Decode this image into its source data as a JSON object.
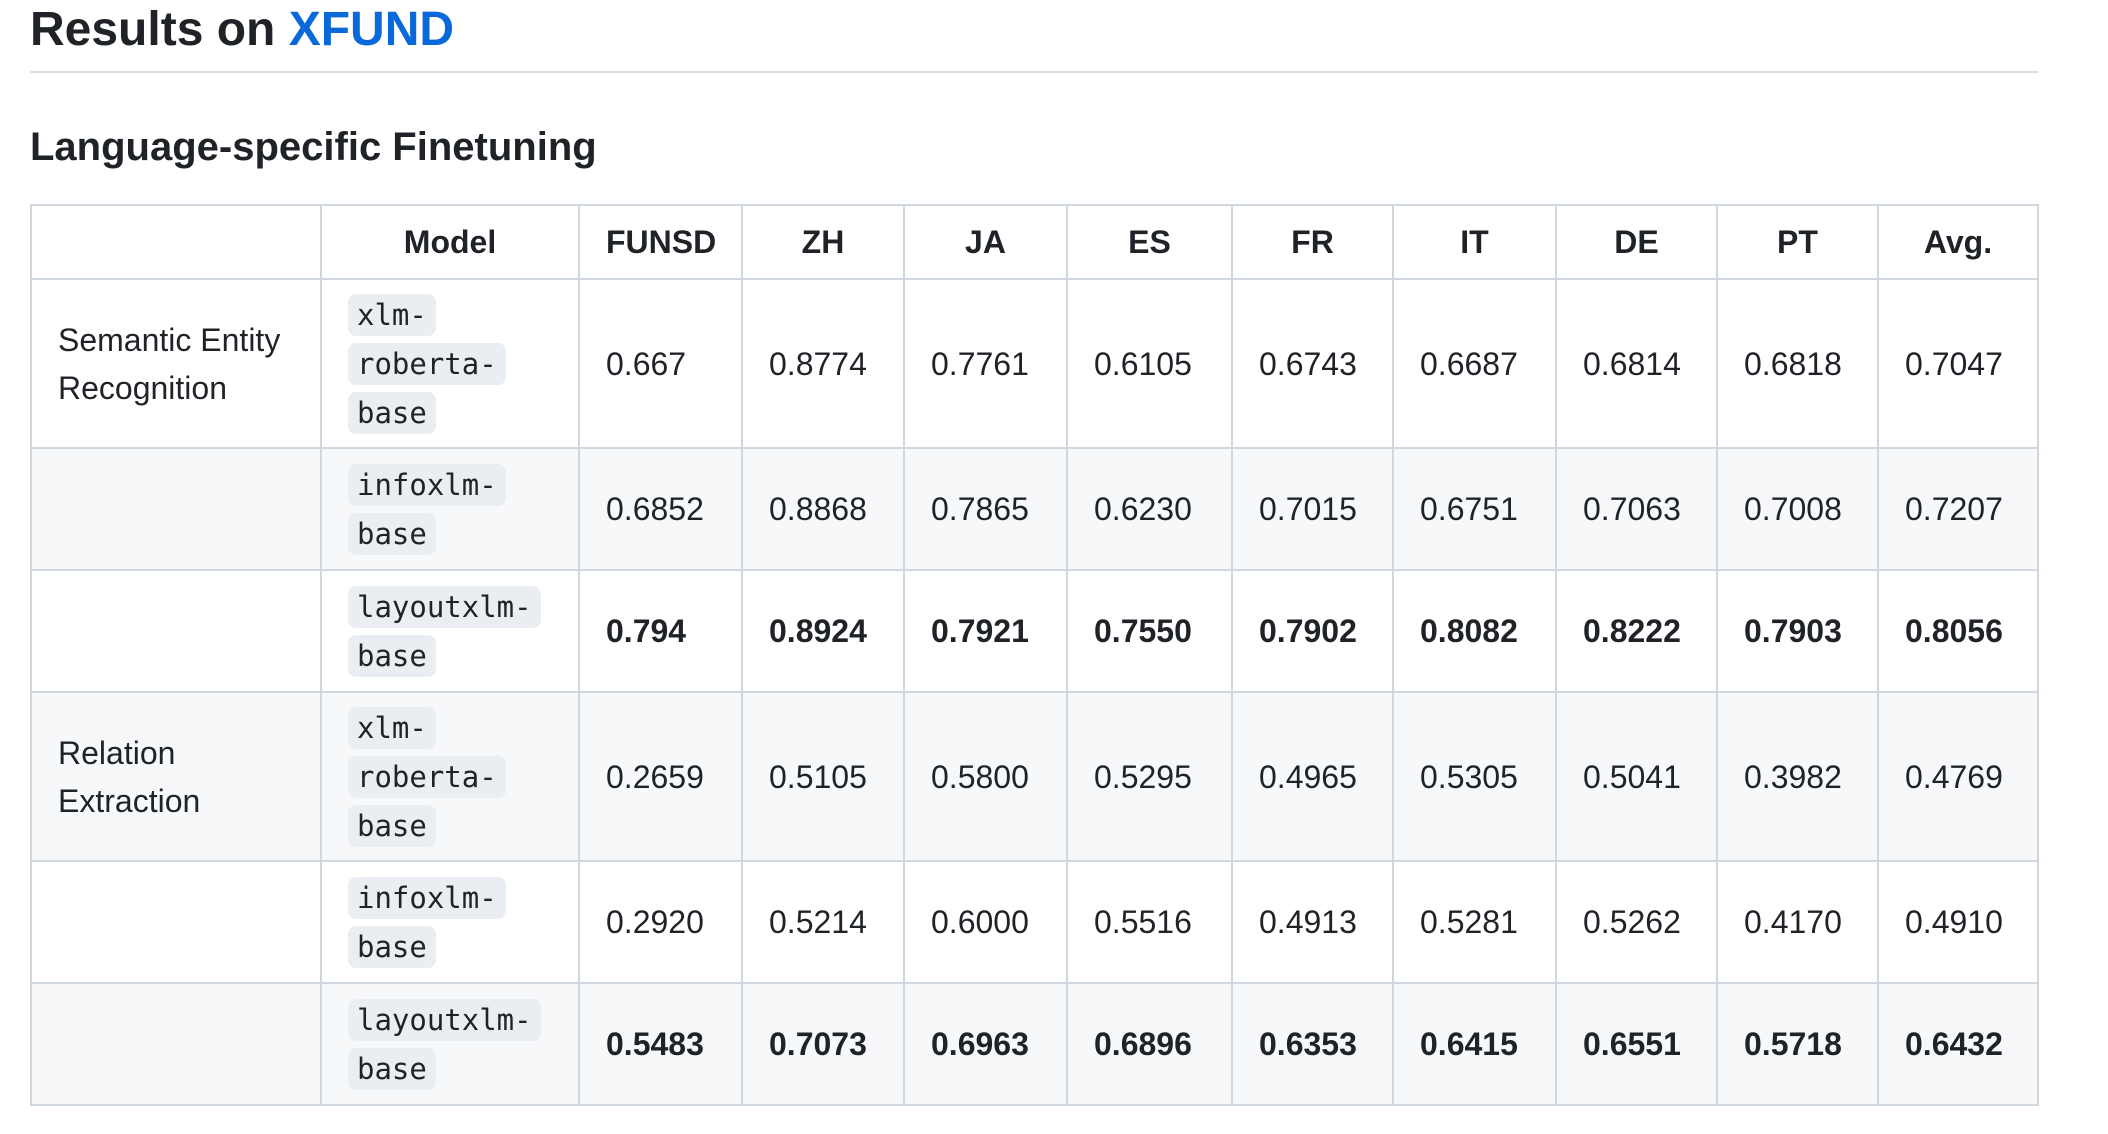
{
  "heading": {
    "prefix": "Results on ",
    "link": "XFUND"
  },
  "subheading": "Language-specific Finetuning",
  "table": {
    "headers": [
      "",
      "Model",
      "FUNSD",
      "ZH",
      "JA",
      "ES",
      "FR",
      "IT",
      "DE",
      "PT",
      "Avg."
    ],
    "rows": [
      {
        "task": "Semantic Entity Recognition",
        "model_lines": [
          "xlm-",
          "roberta-",
          "base"
        ],
        "values": [
          "0.667",
          "0.8774",
          "0.7761",
          "0.6105",
          "0.6743",
          "0.6687",
          "0.6814",
          "0.6818",
          "0.7047"
        ],
        "bold": false
      },
      {
        "task": "",
        "model_lines": [
          "infoxlm-",
          "base"
        ],
        "values": [
          "0.6852",
          "0.8868",
          "0.7865",
          "0.6230",
          "0.7015",
          "0.6751",
          "0.7063",
          "0.7008",
          "0.7207"
        ],
        "bold": false
      },
      {
        "task": "",
        "model_lines": [
          "layoutxlm-",
          "base"
        ],
        "values": [
          "0.794",
          "0.8924",
          "0.7921",
          "0.7550",
          "0.7902",
          "0.8082",
          "0.8222",
          "0.7903",
          "0.8056"
        ],
        "bold": true
      },
      {
        "task": "Relation Extraction",
        "model_lines": [
          "xlm-",
          "roberta-",
          "base"
        ],
        "values": [
          "0.2659",
          "0.5105",
          "0.5800",
          "0.5295",
          "0.4965",
          "0.5305",
          "0.5041",
          "0.3982",
          "0.4769"
        ],
        "bold": false
      },
      {
        "task": "",
        "model_lines": [
          "infoxlm-",
          "base"
        ],
        "values": [
          "0.2920",
          "0.5214",
          "0.6000",
          "0.5516",
          "0.4913",
          "0.5281",
          "0.5262",
          "0.4170",
          "0.4910"
        ],
        "bold": false
      },
      {
        "task": "",
        "model_lines": [
          "layoutxlm-",
          "base"
        ],
        "values": [
          "0.5483",
          "0.7073",
          "0.6963",
          "0.6896",
          "0.6353",
          "0.6415",
          "0.6551",
          "0.5718",
          "0.6432"
        ],
        "bold": true
      }
    ]
  },
  "colors": {
    "link": "#0969da",
    "text": "#1f2328",
    "border": "#d0d7de",
    "alt_row": "#f6f8fa",
    "code_bg": "#eaeef2"
  }
}
